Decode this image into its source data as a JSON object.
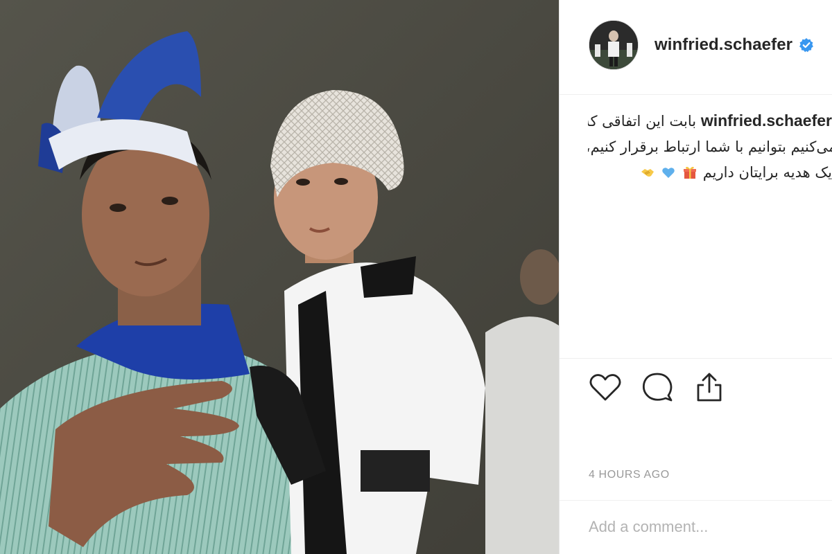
{
  "post": {
    "author": {
      "username": "winfried.schaefer",
      "verified": true,
      "verified_color": "#3897f0"
    },
    "caption": {
      "username": "winfried.schaefer",
      "lines": [
        "بابت این اتفاقی که",
        "سعی می‌کنیم بتوانیم با شما ارتباط برقرار کنیم،",
        "یک هدیه برایتان داریم"
      ],
      "emojis": [
        "gift-emoji",
        "blue-heart-emoji",
        "handshake-emoji"
      ]
    },
    "actions": [
      {
        "name": "like",
        "icon": "heart-outline-icon"
      },
      {
        "name": "comment",
        "icon": "speech-bubble-icon"
      },
      {
        "name": "share",
        "icon": "share-upload-icon"
      }
    ],
    "timestamp": "4 HOURS AGO",
    "comment_input": {
      "placeholder": "Add a comment..."
    }
  },
  "colors": {
    "text": "#262626",
    "muted": "#999999",
    "separator": "#efefef",
    "accent_blue": "#3897f0"
  }
}
